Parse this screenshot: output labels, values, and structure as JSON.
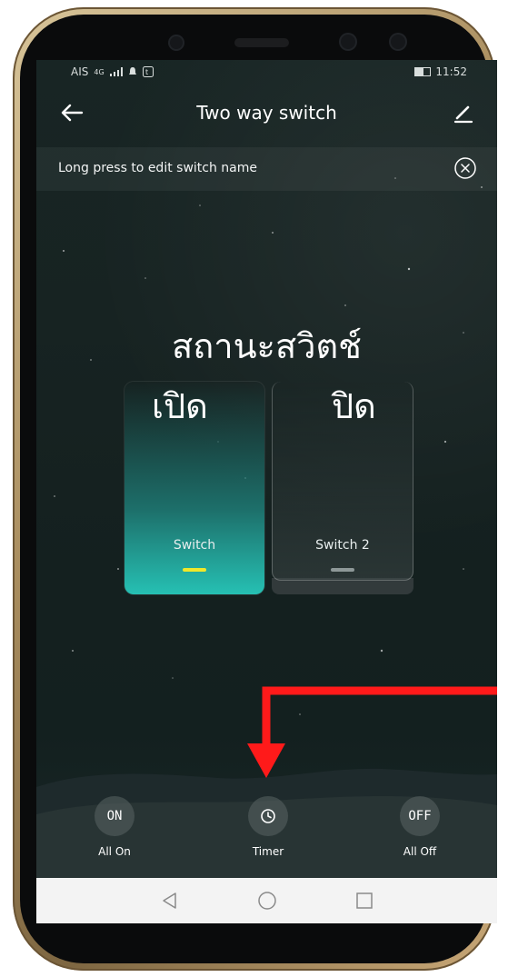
{
  "status_bar": {
    "carrier": "AIS",
    "network": "4G",
    "time": "11:52"
  },
  "header": {
    "title": "Two way switch",
    "back_icon": "arrow-left-icon",
    "edit_icon": "pencil-icon"
  },
  "banner": {
    "text": "Long press to edit switch name",
    "close_icon": "close-circle-icon"
  },
  "overlay": {
    "title": "สถานะสวิตช์",
    "on_label": "เปิด",
    "off_label": "ปิด"
  },
  "switches": [
    {
      "label": "Switch",
      "state": "on",
      "indicator_color": "#f0e82a"
    },
    {
      "label": "Switch 2",
      "state": "off",
      "indicator_color": "#8e9898"
    }
  ],
  "actions": [
    {
      "icon_text": "ON",
      "label": "All On"
    },
    {
      "icon": "clock-icon",
      "label": "Timer"
    },
    {
      "icon_text": "OFF",
      "label": "All Off"
    }
  ],
  "annotation": {
    "arrow_color": "#ff1a1a",
    "target": "Timer"
  },
  "colors": {
    "accent_teal": "#26c0b3",
    "indicator_yellow": "#f0e82a",
    "background": "#172322"
  }
}
